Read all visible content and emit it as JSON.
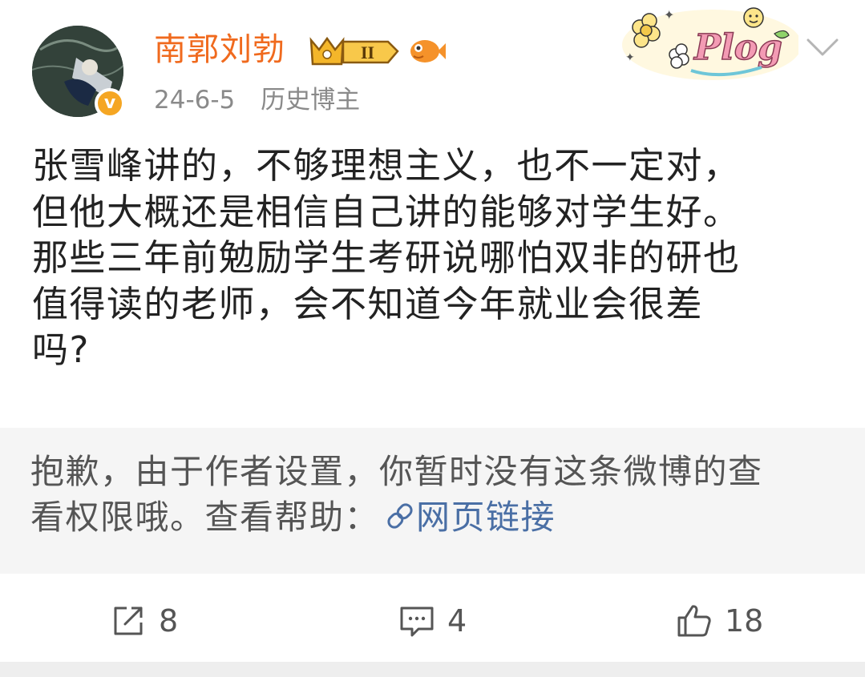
{
  "post": {
    "author": {
      "name": "南郭刘勃",
      "member_level": "II",
      "verified_badge": "v",
      "avatar_icon": "avatar-image"
    },
    "date": "24-6-5",
    "source_label": "历史博主",
    "text_lines": [
      "张雪峰讲的，不够理想主义，也不一定对，",
      "但他大概还是相信自己讲的能够对学生好。",
      "那些三年前勉励学生考研说哪怕双非的研也",
      "值得读的老师，会不知道今年就业会很差",
      "吗?"
    ],
    "decoration": "Plog",
    "notice": {
      "line1": "抱歉，由于作者设置，你暂时没有这条微博的查",
      "line2_prefix": "看权限哦。查看帮助：",
      "link_text": "网页链接"
    },
    "actions": {
      "repost_count": "8",
      "comment_count": "4",
      "like_count": "18"
    }
  },
  "colors": {
    "username": "#f06a1e",
    "link": "#4a6fa5",
    "notice_bg": "#f5f5f5",
    "text": "#222222"
  }
}
